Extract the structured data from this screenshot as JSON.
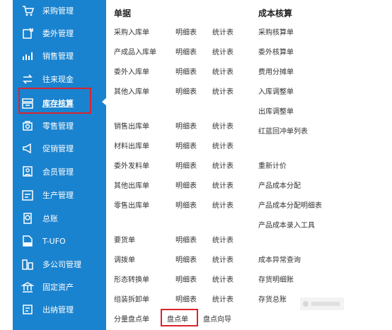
{
  "sidebar": {
    "items": [
      {
        "label": "采购管理",
        "icon": "cart-icon"
      },
      {
        "label": "委外管理",
        "icon": "outsource-icon"
      },
      {
        "label": "销售管理",
        "icon": "sales-chart-icon"
      },
      {
        "label": "往来现金",
        "icon": "exchange-icon"
      },
      {
        "label": "库存核算",
        "icon": "inventory-icon",
        "active": true
      },
      {
        "label": "零售管理",
        "icon": "retail-icon"
      },
      {
        "label": "促销管理",
        "icon": "megaphone-icon"
      },
      {
        "label": "会员管理",
        "icon": "member-icon"
      },
      {
        "label": "生产管理",
        "icon": "production-icon"
      },
      {
        "label": "总账",
        "icon": "ledger-icon"
      },
      {
        "label": "T-UFO",
        "icon": "ufo-report-icon"
      },
      {
        "label": "多公司管理",
        "icon": "multi-company-icon"
      },
      {
        "label": "固定资产",
        "icon": "bank-icon"
      },
      {
        "label": "出纳管理",
        "icon": "cashier-icon"
      }
    ]
  },
  "panel": {
    "documents_header": "单据",
    "cost_header": "成本核算",
    "documents": [
      {
        "name": "采购入库单",
        "detail": "明细表",
        "stats": "统计表"
      },
      {
        "name": "产成品入库单",
        "detail": "明细表",
        "stats": "统计表"
      },
      {
        "name": "委外入库单",
        "detail": "明细表",
        "stats": "统计表"
      },
      {
        "name": "其他入库单",
        "detail": "明细表",
        "stats": "统计表"
      },
      {
        "name": "销售出库单",
        "detail": "明细表",
        "stats": "统计表"
      },
      {
        "name": "材料出库单",
        "detail": "明细表",
        "stats": "统计表"
      },
      {
        "name": "委外发料单",
        "detail": "明细表",
        "stats": "统计表"
      },
      {
        "name": "其他出库单",
        "detail": "明细表",
        "stats": "统计表"
      },
      {
        "name": "零售出库单",
        "detail": "明细表",
        "stats": "统计表"
      },
      {
        "name": "要货单",
        "detail": "明细表",
        "stats": "统计表"
      },
      {
        "name": "调拨单",
        "detail": "明细表",
        "stats": "统计表"
      },
      {
        "name": "形态转换单",
        "detail": "明细表",
        "stats": "统计表"
      },
      {
        "name": "组装拆卸单",
        "detail": "明细表",
        "stats": "统计表"
      },
      {
        "name": "分量盘点单",
        "detail": "盘点单",
        "stats": "盘点向导"
      }
    ],
    "cost_items": [
      "采购核算单",
      "委外核算单",
      "费用分摊单",
      "入库调整单",
      "出库调整单",
      "红蓝回冲单列表",
      "重新计价",
      "产品成本分配",
      "产品成本分配明细表",
      "产品成本录入工具",
      "成本异常查询",
      "存货明细账",
      "存货总账"
    ]
  }
}
